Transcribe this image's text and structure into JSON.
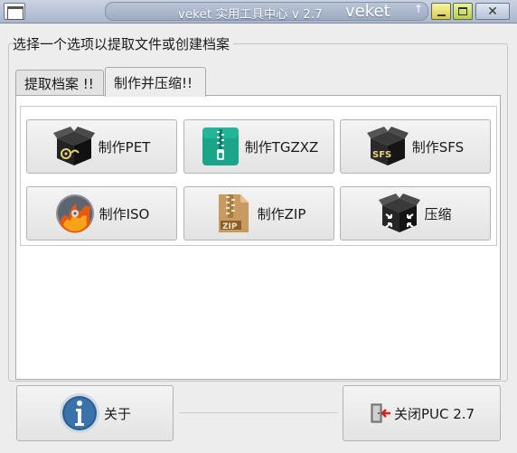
{
  "window": {
    "title": "veket 实用工具中心 v 2.7",
    "brand": "veket",
    "up_arrow": "↑",
    "min_label": "",
    "close_glyph": "✕"
  },
  "frame": {
    "label": "选择一个选项以提取文件或创建档案"
  },
  "tabs": [
    {
      "label": "提取档案 !!",
      "selected": false
    },
    {
      "label": "制作并压缩!!",
      "selected": true
    }
  ],
  "actions": [
    {
      "label": "制作PET",
      "icon": "box-pet-icon"
    },
    {
      "label": "制作TGZXZ",
      "icon": "zipper-file-icon"
    },
    {
      "label": "制作SFS",
      "icon": "box-sfs-icon"
    },
    {
      "label": "制作ISO",
      "icon": "disc-flame-icon"
    },
    {
      "label": "制作ZIP",
      "icon": "zip-file-icon"
    },
    {
      "label": "压缩",
      "icon": "compress-box-icon"
    }
  ],
  "footer": {
    "about_label": "关于",
    "close_label": "关闭PUC 2.7"
  },
  "colors": {
    "titlebar": "#aab7cc",
    "background": "#ededed",
    "panel": "#ffffff",
    "teal_icon": "#1aa58a",
    "zip_brown": "#b98a52",
    "info_blue": "#2a5d8f"
  }
}
